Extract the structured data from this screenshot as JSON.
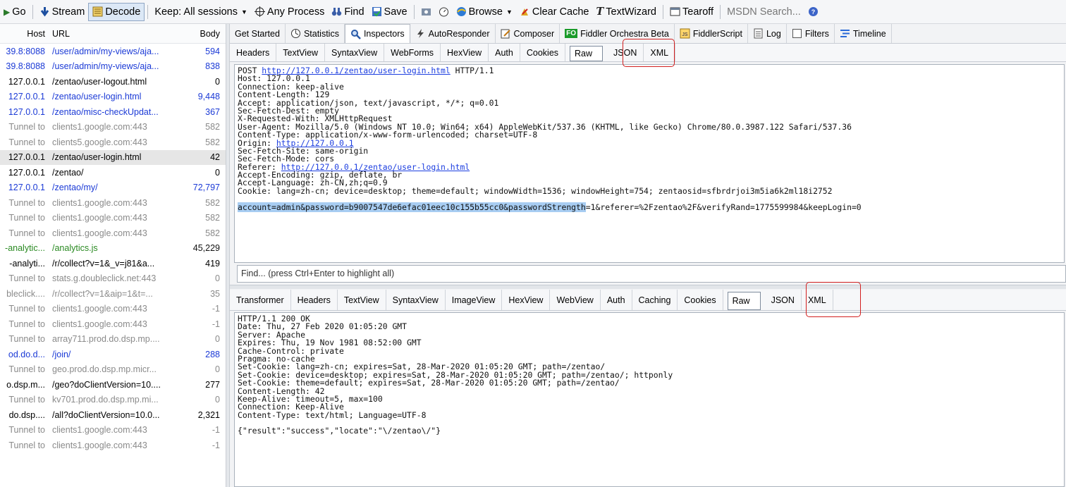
{
  "toolbar": {
    "items": [
      {
        "label": "Go",
        "icon": "go-arrow-icon"
      },
      {
        "label": "Stream",
        "icon": "stream-icon"
      },
      {
        "label": "Decode",
        "icon": "decode-icon"
      },
      {
        "label": "Keep: All sessions"
      },
      {
        "label": "Any Process",
        "icon": "crosshair-icon"
      },
      {
        "label": "Find",
        "icon": "binoculars-icon"
      },
      {
        "label": "Save",
        "icon": "save-icon"
      },
      {
        "label": "Browse",
        "icon": "browser-icon"
      },
      {
        "label": "Clear Cache",
        "icon": "clear-cache-icon"
      },
      {
        "label": "TextWizard",
        "icon": "textwizard-icon"
      },
      {
        "label": "Tearoff",
        "icon": "tearoff-icon"
      },
      {
        "label": "MSDN Search...",
        "icon": "help-icon"
      }
    ]
  },
  "sessions": {
    "headers": {
      "host": "Host",
      "url": "URL",
      "body": "Body"
    },
    "rows": [
      {
        "host": "39.8:8088",
        "url": "/user/admin/my-views/aja...",
        "body": "594",
        "style": "blue"
      },
      {
        "host": "39.8:8088",
        "url": "/user/admin/my-views/aja...",
        "body": "838",
        "style": "blue"
      },
      {
        "host": "127.0.0.1",
        "url": "/zentao/user-logout.html",
        "body": "0",
        "style": "black"
      },
      {
        "host": "127.0.0.1",
        "url": "/zentao/user-login.html",
        "body": "9,448",
        "style": "blue"
      },
      {
        "host": "127.0.0.1",
        "url": "/zentao/misc-checkUpdat...",
        "body": "367",
        "style": "blue"
      },
      {
        "host": "Tunnel to",
        "url": "clients1.google.com:443",
        "body": "582",
        "style": "gray"
      },
      {
        "host": "Tunnel to",
        "url": "clients5.google.com:443",
        "body": "582",
        "style": "gray"
      },
      {
        "host": "127.0.0.1",
        "url": "/zentao/user-login.html",
        "body": "42",
        "style": "selected"
      },
      {
        "host": "127.0.0.1",
        "url": "/zentao/",
        "body": "0",
        "style": "black"
      },
      {
        "host": "127.0.0.1",
        "url": "/zentao/my/",
        "body": "72,797",
        "style": "blue"
      },
      {
        "host": "Tunnel to",
        "url": "clients1.google.com:443",
        "body": "582",
        "style": "gray"
      },
      {
        "host": "Tunnel to",
        "url": "clients1.google.com:443",
        "body": "582",
        "style": "gray"
      },
      {
        "host": "Tunnel to",
        "url": "clients1.google.com:443",
        "body": "582",
        "style": "gray"
      },
      {
        "host": "-analytic...",
        "url": "/analytics.js",
        "body": "45,229",
        "style": "green"
      },
      {
        "host": "-analyti...",
        "url": "/r/collect?v=1&_v=j81&a...",
        "body": "419",
        "style": "black"
      },
      {
        "host": "Tunnel to",
        "url": "stats.g.doubleclick.net:443",
        "body": "0",
        "style": "gray"
      },
      {
        "host": "bleclick....",
        "url": "/r/collect?v=1&aip=1&t=...",
        "body": "35",
        "style": "gray"
      },
      {
        "host": "Tunnel to",
        "url": "clients1.google.com:443",
        "body": "-1",
        "style": "gray"
      },
      {
        "host": "Tunnel to",
        "url": "clients1.google.com:443",
        "body": "-1",
        "style": "gray"
      },
      {
        "host": "Tunnel to",
        "url": "array711.prod.do.dsp.mp....",
        "body": "0",
        "style": "gray"
      },
      {
        "host": "od.do.d...",
        "url": "/join/",
        "body": "288",
        "style": "blue"
      },
      {
        "host": "Tunnel to",
        "url": "geo.prod.do.dsp.mp.micr...",
        "body": "0",
        "style": "gray"
      },
      {
        "host": "o.dsp.m...",
        "url": "/geo?doClientVersion=10....",
        "body": "277",
        "style": "black"
      },
      {
        "host": "Tunnel to",
        "url": "kv701.prod.do.dsp.mp.mi...",
        "body": "0",
        "style": "gray"
      },
      {
        "host": "do.dsp....",
        "url": "/all?doClientVersion=10.0...",
        "body": "2,321",
        "style": "black"
      },
      {
        "host": "Tunnel to",
        "url": "clients1.google.com:443",
        "body": "-1",
        "style": "gray"
      },
      {
        "host": "Tunnel to",
        "url": "clients1.google.com:443",
        "body": "-1",
        "style": "gray"
      }
    ]
  },
  "main_tabs": [
    {
      "label": "Get Started",
      "icon": ""
    },
    {
      "label": "Statistics",
      "icon": "statistics-icon"
    },
    {
      "label": "Inspectors",
      "icon": "inspectors-icon",
      "active": true
    },
    {
      "label": "AutoResponder",
      "icon": "lightning-icon"
    },
    {
      "label": "Composer",
      "icon": "composer-icon"
    },
    {
      "label": "Fiddler Orchestra Beta",
      "icon": "fo-icon",
      "badge": "FO"
    },
    {
      "label": "FiddlerScript",
      "icon": "script-icon"
    },
    {
      "label": "Log",
      "icon": "log-icon"
    },
    {
      "label": "Filters",
      "icon": "checkbox-icon"
    },
    {
      "label": "Timeline",
      "icon": "timeline-icon"
    }
  ],
  "request_tabs": [
    "Headers",
    "TextView",
    "SyntaxView",
    "WebForms",
    "HexView",
    "Auth",
    "Cookies",
    "Raw",
    "JSON",
    "XML"
  ],
  "request_active": "Raw",
  "request": {
    "lines": [
      [
        {
          "t": "POST "
        },
        {
          "t": "http://127.0.0.1/zentao/user-login.html",
          "link": true
        },
        {
          "t": " HTTP/1.1"
        }
      ],
      [
        {
          "t": "Host: 127.0.0.1"
        }
      ],
      [
        {
          "t": "Connection: keep-alive"
        }
      ],
      [
        {
          "t": "Content-Length: 129"
        }
      ],
      [
        {
          "t": "Accept: application/json, text/javascript, */*; q=0.01"
        }
      ],
      [
        {
          "t": "Sec-Fetch-Dest: empty"
        }
      ],
      [
        {
          "t": "X-Requested-With: XMLHttpRequest"
        }
      ],
      [
        {
          "t": "User-Agent: Mozilla/5.0 (Windows NT 10.0; Win64; x64) AppleWebKit/537.36 (KHTML, like Gecko) Chrome/80.0.3987.122 Safari/537.36"
        }
      ],
      [
        {
          "t": "Content-Type: application/x-www-form-urlencoded; charset=UTF-8"
        }
      ],
      [
        {
          "t": "Origin: "
        },
        {
          "t": "http://127.0.0.1",
          "link": true
        }
      ],
      [
        {
          "t": "Sec-Fetch-Site: same-origin"
        }
      ],
      [
        {
          "t": "Sec-Fetch-Mode: cors"
        }
      ],
      [
        {
          "t": "Referer: "
        },
        {
          "t": "http://127.0.0.1/zentao/user-login.html",
          "link": true
        }
      ],
      [
        {
          "t": "Accept-Encoding: gzip, deflate, br"
        }
      ],
      [
        {
          "t": "Accept-Language: zh-CN,zh;q=0.9"
        }
      ],
      [
        {
          "t": "Cookie: lang=zh-cn; device=desktop; theme=default; windowWidth=1536; windowHeight=754; zentaosid=sfbrdrjoi3m5ia6k2ml18i2752"
        }
      ],
      [
        {
          "t": ""
        }
      ],
      [
        {
          "t": "account=admin&password=b9007547de6efac01eec10c155b55cc0&passwordStrength",
          "hl": true
        },
        {
          "t": "=1&referer=%2Fzentao%2F&verifyRand=1775599984&keepLogin=0"
        }
      ]
    ]
  },
  "find_placeholder": "Find... (press Ctrl+Enter to highlight all)",
  "response_tabs": [
    "Transformer",
    "Headers",
    "TextView",
    "SyntaxView",
    "ImageView",
    "HexView",
    "WebView",
    "Auth",
    "Caching",
    "Cookies",
    "Raw",
    "JSON",
    "XML"
  ],
  "response_active": "Raw",
  "response": {
    "lines": [
      [
        {
          "t": "HTTP/1.1 200 OK"
        }
      ],
      [
        {
          "t": "Date: Thu, 27 Feb 2020 01:05:20 GMT"
        }
      ],
      [
        {
          "t": "Server: Apache"
        }
      ],
      [
        {
          "t": "Expires: Thu, 19 Nov 1981 08:52:00 GMT"
        }
      ],
      [
        {
          "t": "Cache-Control: private"
        }
      ],
      [
        {
          "t": "Pragma: no-cache"
        }
      ],
      [
        {
          "t": "Set-Cookie: lang=zh-cn; expires=Sat, 28-Mar-2020 01:05:20 GMT; path=/zentao/"
        }
      ],
      [
        {
          "t": "Set-Cookie: device=desktop; expires=Sat, 28-Mar-2020 01:05:20 GMT; path=/zentao/; httponly"
        }
      ],
      [
        {
          "t": "Set-Cookie: theme=default; expires=Sat, 28-Mar-2020 01:05:20 GMT; path=/zentao/"
        }
      ],
      [
        {
          "t": "Content-Length: 42"
        }
      ],
      [
        {
          "t": "Keep-Alive: timeout=5, max=100"
        }
      ],
      [
        {
          "t": "Connection: Keep-Alive"
        }
      ],
      [
        {
          "t": "Content-Type: text/html; Language=UTF-8"
        }
      ],
      [
        {
          "t": ""
        }
      ],
      [
        {
          "t": "{\"result\":\"success\",\"locate\":\"\\/zentao\\/\"}"
        }
      ]
    ]
  },
  "colors": {
    "annotation_red": "#d21f1f",
    "link_blue": "#1c3ee0",
    "selection": "#a8cdf2"
  }
}
